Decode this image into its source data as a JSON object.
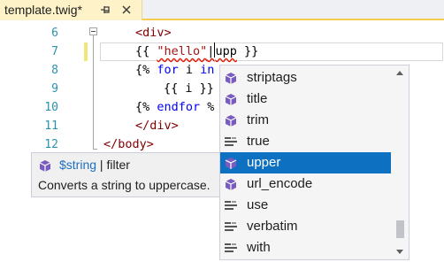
{
  "tab": {
    "title": "template.twig*"
  },
  "editor": {
    "line_numbers": [
      "6",
      "7",
      "8",
      "9",
      "10",
      "11",
      "12"
    ]
  },
  "quick_info": {
    "variable": "$string",
    "separator": " | ",
    "kind": "filter",
    "description": "Converts a string to uppercase."
  },
  "completion": {
    "items": [
      {
        "label": "striptags",
        "icon": "filter-cube-icon"
      },
      {
        "label": "title",
        "icon": "filter-cube-icon"
      },
      {
        "label": "trim",
        "icon": "filter-cube-icon"
      },
      {
        "label": "true",
        "icon": "keyword-lines-icon"
      },
      {
        "label": "upper",
        "icon": "filter-cube-icon",
        "selected": true
      },
      {
        "label": "url_encode",
        "icon": "filter-cube-icon"
      },
      {
        "label": "use",
        "icon": "keyword-lines-icon"
      },
      {
        "label": "verbatim",
        "icon": "keyword-lines-icon"
      },
      {
        "label": "with",
        "icon": "keyword-lines-icon"
      }
    ]
  },
  "colors": {
    "tab_active": "#fef2c8",
    "tab_accent": "#f5cc51",
    "line_number": "#2b91af",
    "selection": "#0e70c0",
    "filter_icon": "#7a5bc0"
  }
}
